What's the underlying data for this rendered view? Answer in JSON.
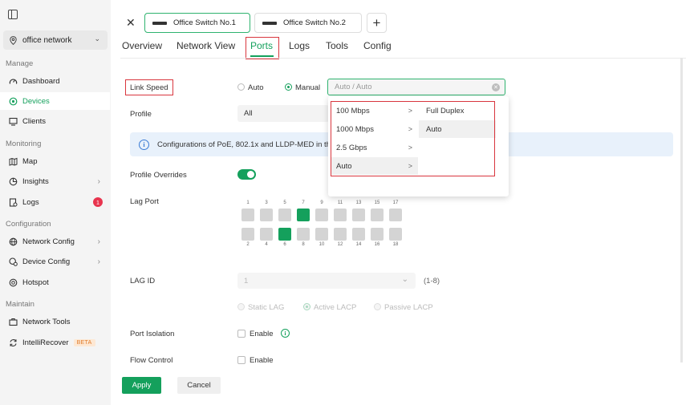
{
  "sidebar": {
    "site": "office network",
    "sections": {
      "manage": "Manage",
      "monitoring": "Monitoring",
      "configuration": "Configuration",
      "maintain": "Maintain"
    },
    "items": {
      "dashboard": "Dashboard",
      "devices": "Devices",
      "clients": "Clients",
      "map": "Map",
      "insights": "Insights",
      "logs": "Logs",
      "logs_badge": "1",
      "network_config": "Network Config",
      "device_config": "Device Config",
      "hotspot": "Hotspot",
      "network_tools": "Network Tools",
      "intellirecover": "IntelliRecover",
      "beta": "BETA"
    }
  },
  "device_tabs": [
    "Office Switch No.1",
    "Office Switch No.2"
  ],
  "section_tabs": {
    "overview": "Overview",
    "network_view": "Network View",
    "ports": "Ports",
    "logs": "Logs",
    "tools": "Tools",
    "config": "Config"
  },
  "form": {
    "link_speed_label": "Link Speed",
    "link_speed_auto": "Auto",
    "link_speed_manual": "Manual",
    "link_speed_value": "Auto / Auto",
    "profile_label": "Profile",
    "profile_value": "All",
    "info_text": "Configurations of PoE, 802.1x and LLDP-MED in the p",
    "profile_overrides_label": "Profile Overrides",
    "lag_port_label": "Lag Port",
    "lag_id_label": "LAG ID",
    "lag_id_value": "1",
    "lag_range": "(1-8)",
    "static_lag": "Static LAG",
    "active_lacp": "Active LACP",
    "passive_lacp": "Passive LACP",
    "port_isolation_label": "Port Isolation",
    "port_isolation_enable": "Enable",
    "flow_control_label": "Flow Control",
    "flow_control_enable": "Enable"
  },
  "ports": {
    "top_numbers": [
      "1",
      "3",
      "5",
      "7",
      "9",
      "11",
      "13",
      "15",
      "17"
    ],
    "bottom_numbers": [
      "2",
      "4",
      "6",
      "8",
      "10",
      "12",
      "14",
      "16",
      "18"
    ],
    "active_top": [
      "7"
    ],
    "active_bottom": [
      "6"
    ]
  },
  "dropdown": {
    "speeds": [
      "100 Mbps",
      "1000 Mbps",
      "2.5 Gbps",
      "Auto"
    ],
    "duplex": [
      "Full Duplex",
      "Auto"
    ]
  },
  "buttons": {
    "apply": "Apply",
    "cancel": "Cancel"
  },
  "colors": {
    "accent": "#14a05c",
    "highlight": "#d9363e",
    "badge": "#e8344e",
    "info": "#3a7bd5"
  }
}
